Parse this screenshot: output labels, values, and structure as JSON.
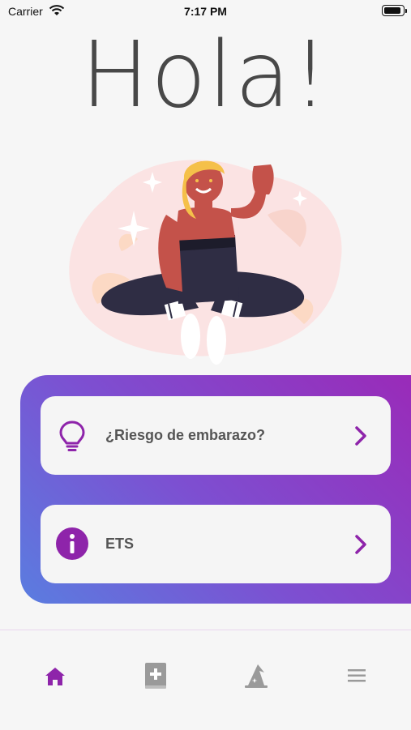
{
  "status_bar": {
    "carrier": "Carrier",
    "time": "7:17 PM"
  },
  "greeting": "Hola!",
  "menu": [
    {
      "label": "¿Riesgo de embarazo?",
      "icon": "lightbulb-icon"
    },
    {
      "label": "ETS",
      "icon": "info-icon"
    }
  ],
  "bottom_nav": [
    {
      "icon": "home-icon",
      "active": true
    },
    {
      "icon": "medical-book-icon",
      "active": false
    },
    {
      "icon": "wizard-hat-icon",
      "active": false
    },
    {
      "icon": "hamburger-menu-icon",
      "active": false
    }
  ],
  "colors": {
    "accent": "#8e24aa",
    "panel_gradient_start": "#9a2ab8",
    "panel_gradient_end": "#5a7de0",
    "inactive_icon": "#9a9a9a"
  }
}
